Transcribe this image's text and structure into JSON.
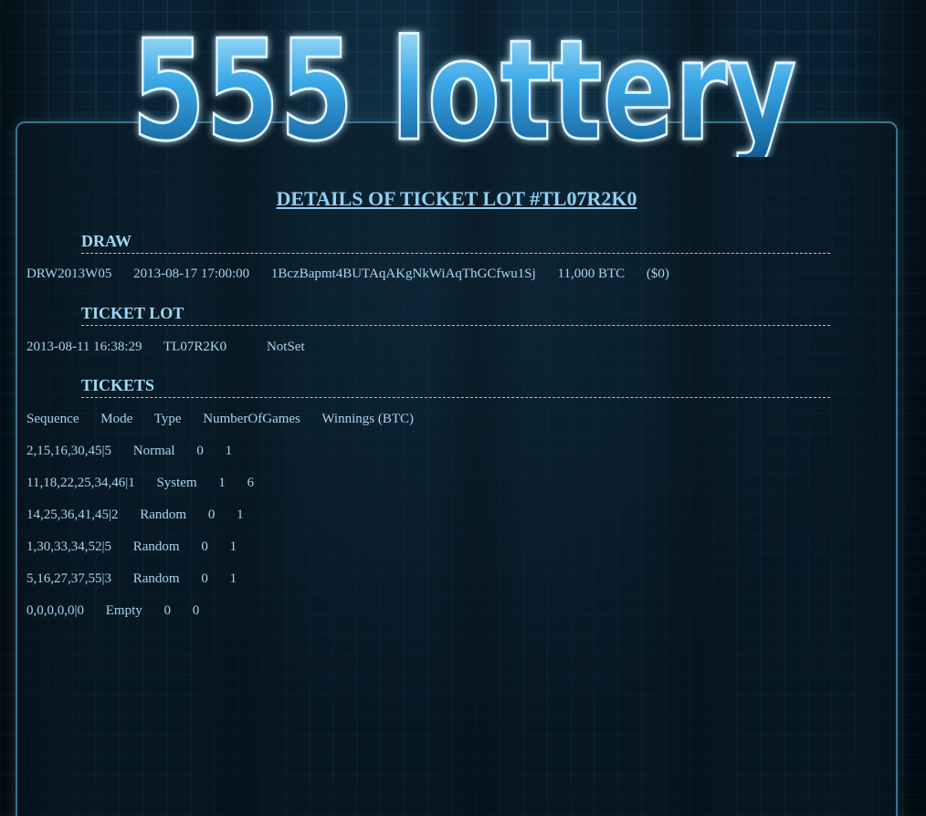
{
  "logo": {
    "text": "555 lottery"
  },
  "page": {
    "title": "DETAILS OF TICKET LOT #TL07R2K0"
  },
  "draw": {
    "heading": "DRAW",
    "id": "DRW2013W05",
    "datetime": "2013-08-17 17:00:00",
    "address": "1BczBapmt4BUTAqAKgNkWiAqThGCfwu1Sj",
    "jackpot": "11,000 BTC",
    "usd": "($0)"
  },
  "ticket_lot": {
    "heading": "TICKET LOT",
    "datetime": "2013-08-11 16:38:29",
    "id": "TL07R2K0",
    "status": "NotSet"
  },
  "tickets": {
    "heading": "TICKETS",
    "columns": [
      "Sequence",
      "Mode",
      "Type",
      "NumberOfGames",
      "Winnings (BTC)"
    ],
    "rows": [
      {
        "sequence": "2,15,16,30,45|5",
        "mode": "Normal",
        "type": "0",
        "games": "1"
      },
      {
        "sequence": "11,18,22,25,34,46|1",
        "mode": "System",
        "type": "1",
        "games": "6"
      },
      {
        "sequence": "14,25,36,41,45|2",
        "mode": "Random",
        "type": "0",
        "games": "1"
      },
      {
        "sequence": "1,30,33,34,52|5",
        "mode": "Random",
        "type": "0",
        "games": "1"
      },
      {
        "sequence": "5,16,27,37,55|3",
        "mode": "Random",
        "type": "0",
        "games": "1"
      },
      {
        "sequence": "0,0,0,0,0|0",
        "mode": "Empty",
        "type": "0",
        "games": "0"
      }
    ]
  },
  "colors": {
    "text": "#a9d4ee",
    "heading": "#9fd9f8",
    "panel_border": "#3a7390",
    "background": "#05121c"
  }
}
